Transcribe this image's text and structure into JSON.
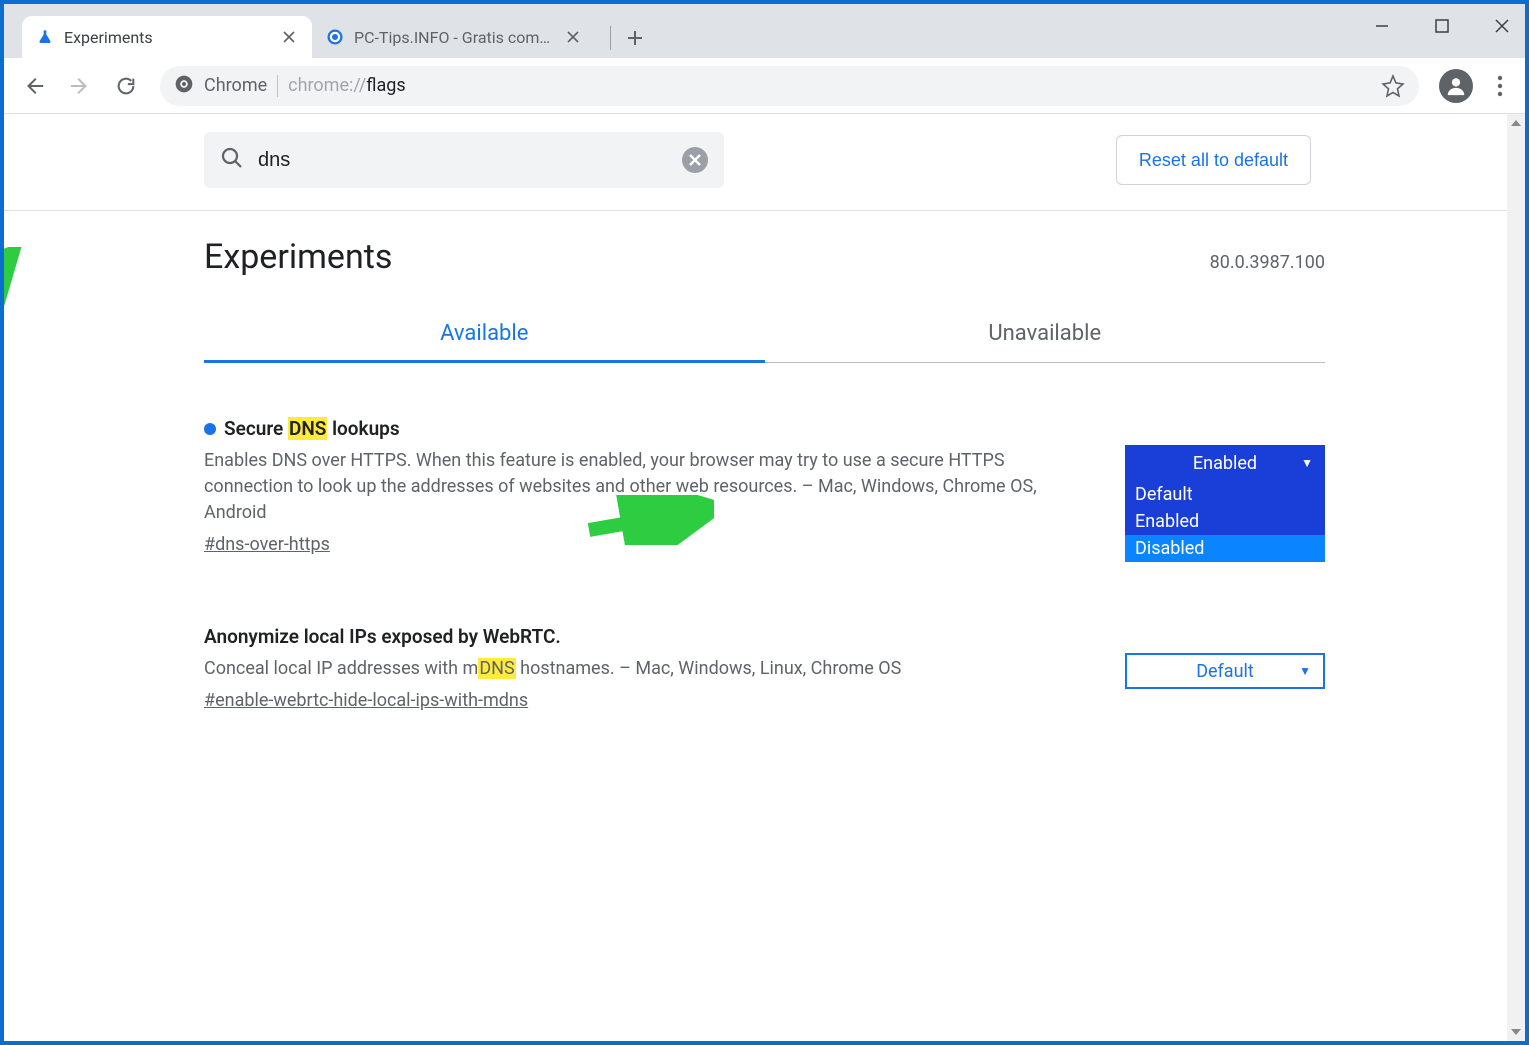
{
  "window": {
    "tabs": [
      {
        "title": "Experiments",
        "active": true
      },
      {
        "title": "PC-Tips.INFO - Gratis computer t",
        "active": false
      }
    ]
  },
  "toolbar": {
    "url_prefix": "Chrome",
    "url_path_grey": "chrome://",
    "url_path_strong": "flags"
  },
  "page": {
    "search_value": "dns",
    "reset_label": "Reset all to default",
    "heading": "Experiments",
    "version": "80.0.3987.100",
    "tabs": {
      "available": "Available",
      "unavailable": "Unavailable"
    },
    "flags": [
      {
        "title_pre": "Secure ",
        "title_mark": "DNS",
        "title_post": " lookups",
        "desc": "Enables DNS over HTTPS. When this feature is enabled, your browser may try to use a secure HTTPS connection to look up the addresses of websites and other web resources. – Mac, Windows, Chrome OS, Android",
        "anchor": "#dns-over-https",
        "select_value": "Enabled",
        "has_dot": true,
        "options": [
          "Default",
          "Enabled",
          "Disabled"
        ]
      },
      {
        "title_full": "Anonymize local IPs exposed by WebRTC.",
        "desc_pre": "Conceal local IP addresses with m",
        "desc_mark": "DNS",
        "desc_post": " hostnames. – Mac, Windows, Linux, Chrome OS",
        "anchor": "#enable-webrtc-hide-local-ips-with-mdns",
        "select_value": "Default"
      }
    ]
  }
}
